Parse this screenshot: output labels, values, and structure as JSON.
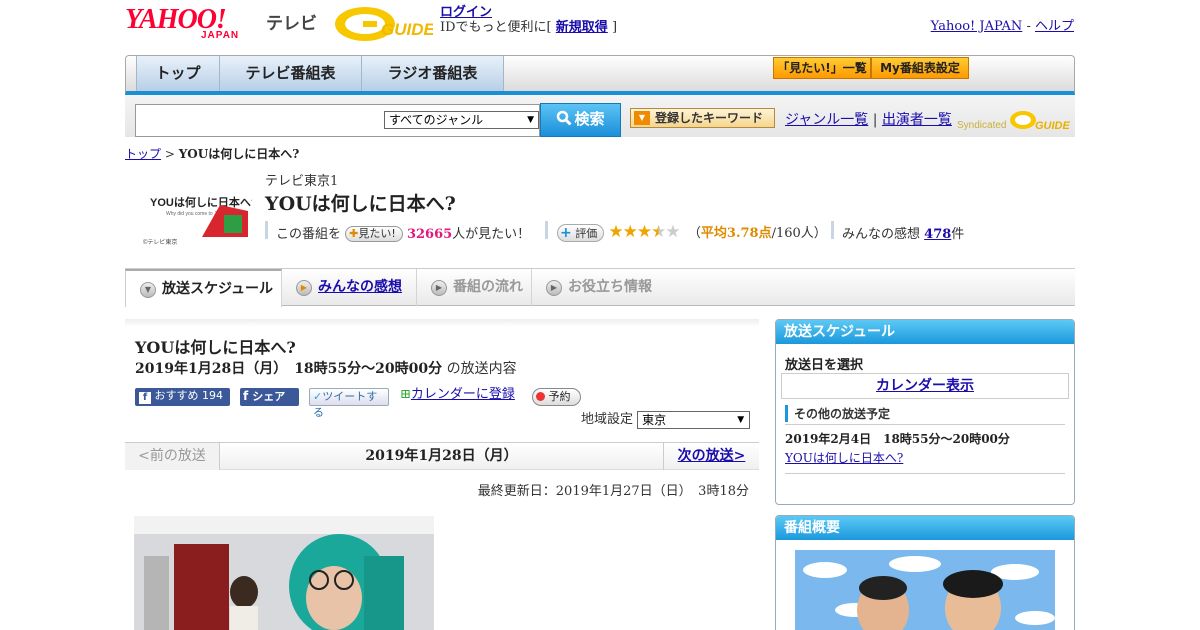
{
  "header": {
    "logo_text": "YAHOO!",
    "logo_sub": "JAPAN",
    "service": "テレビ",
    "gguide": "G GUIDE",
    "login": "ログイン",
    "login_desc_pre": "IDでもっと便利に[",
    "signup": "新規取得",
    "login_desc_post": "]",
    "yahoo_japan": "Yahoo! JAPAN",
    "dash": "-",
    "help": "ヘルプ"
  },
  "nav": {
    "tabs": [
      "トップ",
      "テレビ番組表",
      "ラジオ番組表"
    ],
    "mitai_list": "「見たい!」一覧",
    "my_schedule": "My番組表設定"
  },
  "search": {
    "placeholder": "",
    "genre": "すべてのジャンル",
    "button": "検索",
    "keyword_button": "登録したキーワード",
    "genre_list": "ジャンル一覧",
    "divider": "|",
    "cast_list": "出演者一覧",
    "syndicated": "Syndicated"
  },
  "breadcrumb": {
    "top": "トップ",
    "sep": ">",
    "current": "YOUは何しに日本へ?"
  },
  "program": {
    "logo_title": "YOUは何しに日本へ?",
    "logo_sub": "Why did you come to Japan?",
    "logo_copy": "©テレビ東京",
    "channel": "テレビ東京1",
    "title": "YOUは何しに日本へ?",
    "mitai_pre": "この番組を",
    "mitai_btn": "見たい!",
    "mitai_count": "32665",
    "mitai_post": "人が見たい！",
    "hyoka_btn": "評価",
    "rating": 3.78,
    "rating_open": "（",
    "rating_label": "平均3.78点",
    "rating_count": "/160人）",
    "kanso_pre": "みんなの感想",
    "kanso_count": "478",
    "kanso_post": "件"
  },
  "program_tabs": [
    "放送スケジュール",
    "みんなの感想",
    "番組の流れ",
    "お役立ち情報"
  ],
  "main": {
    "title": "YOUは何しに日本へ?",
    "air_time": "2019年1月28日（月）　18時55分～20時00分",
    "air_suffix": "の放送内容",
    "fb_recommend": "おすすめ 194",
    "fb_share": "シェア",
    "tweet": "ツイートする",
    "calendar": "カレンダーに登録",
    "reserve": "予約",
    "region_label": "地域設定",
    "region": "東京",
    "prev": "<前の放送",
    "current_date": "2019年1月28日（月）",
    "next": "次の放送>",
    "updated": "最終更新日：2019年1月27日（日）　3時18分"
  },
  "sidebar": {
    "schedule_head": "放送スケジュール",
    "select_day": "放送日を選択",
    "calendar_view": "カレンダー表示",
    "other_head": "その他の放送予定",
    "other_date": "2019年2月4日　18時55分～20時00分",
    "other_title": "YOUは何しに日本へ?",
    "summary_head": "番組概要"
  },
  "colors": {
    "accent_blue": "#1b98dc",
    "yahoo_red": "#ff0033",
    "orange": "#ff9900",
    "pink": "#e0197d"
  }
}
